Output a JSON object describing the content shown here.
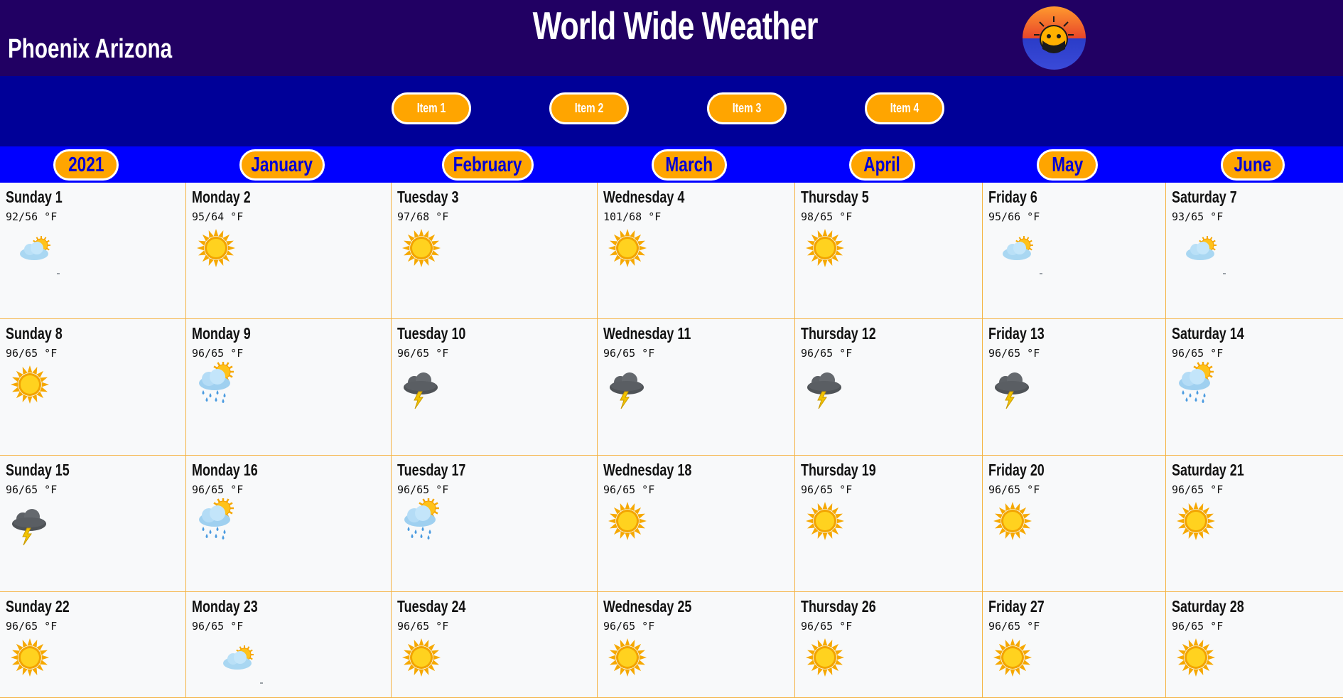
{
  "header": {
    "title": "World Wide Weather",
    "location": "Phoenix Arizona"
  },
  "nav": {
    "items": [
      "Item 1",
      "Item 2",
      "Item 3",
      "Item 4"
    ]
  },
  "months": [
    "2021",
    "January",
    "February",
    "March",
    "April",
    "May",
    "June"
  ],
  "colors": {
    "header_bg": "#210063",
    "nav_bg": "#000098",
    "month_bar_bg": "#0000ff",
    "button_bg": "#ffa500",
    "month_text": "#0000d6",
    "cell_border": "#f5b342"
  },
  "days": [
    {
      "label": "Sunday 1",
      "temp": "92/56 °F",
      "icon": "partly-cloudy-icon"
    },
    {
      "label": "Monday 2",
      "temp": "95/64 °F",
      "icon": "sun-icon"
    },
    {
      "label": "Tuesday 3",
      "temp": "97/68 °F",
      "icon": "sun-icon"
    },
    {
      "label": "Wednesday 4",
      "temp": "101/68 °F",
      "icon": "sun-icon"
    },
    {
      "label": "Thursday 5",
      "temp": "98/65 °F",
      "icon": "sun-icon"
    },
    {
      "label": "Friday 6",
      "temp": "95/66 °F",
      "icon": "partly-cloudy-icon"
    },
    {
      "label": "Saturday 7",
      "temp": "93/65 °F",
      "icon": "partly-cloudy-icon"
    },
    {
      "label": "Sunday 8",
      "temp": "96/65 °F",
      "icon": "sun-icon"
    },
    {
      "label": "Monday 9",
      "temp": "96/65 °F",
      "icon": "sun-rain-icon"
    },
    {
      "label": "Tuesday 10",
      "temp": "96/65 °F",
      "icon": "thunderstorm-icon"
    },
    {
      "label": "Wednesday 11",
      "temp": "96/65 °F",
      "icon": "thunderstorm-icon"
    },
    {
      "label": "Thursday 12",
      "temp": "96/65 °F",
      "icon": "thunderstorm-icon"
    },
    {
      "label": "Friday 13",
      "temp": "96/65 °F",
      "icon": "thunderstorm-icon"
    },
    {
      "label": "Saturday 14",
      "temp": "96/65 °F",
      "icon": "sun-rain-icon"
    },
    {
      "label": "Sunday 15",
      "temp": "96/65 °F",
      "icon": "thunderstorm-icon"
    },
    {
      "label": "Monday 16",
      "temp": "96/65 °F",
      "icon": "sun-rain-icon"
    },
    {
      "label": "Tuesday 17",
      "temp": "96/65 °F",
      "icon": "sun-rain-icon"
    },
    {
      "label": "Wednesday 18",
      "temp": "96/65 °F",
      "icon": "sun-icon"
    },
    {
      "label": "Thursday 19",
      "temp": "96/65 °F",
      "icon": "sun-icon"
    },
    {
      "label": "Friday 20",
      "temp": "96/65 °F",
      "icon": "sun-icon"
    },
    {
      "label": "Saturday 21",
      "temp": "96/65 °F",
      "icon": "sun-icon"
    },
    {
      "label": "Sunday 22",
      "temp": "96/65 °F",
      "icon": "sun-icon"
    },
    {
      "label": "Monday 23",
      "temp": "96/65 °F",
      "icon": "partly-cloudy-icon"
    },
    {
      "label": "Tuesday 24",
      "temp": "96/65 °F",
      "icon": "sun-icon"
    },
    {
      "label": "Wednesday 25",
      "temp": "96/65 °F",
      "icon": "sun-icon"
    },
    {
      "label": "Thursday 26",
      "temp": "96/65 °F",
      "icon": "sun-icon"
    },
    {
      "label": "Friday 27",
      "temp": "96/65 °F",
      "icon": "sun-icon"
    },
    {
      "label": "Saturday 28",
      "temp": "96/65 °F",
      "icon": "sun-icon"
    }
  ]
}
